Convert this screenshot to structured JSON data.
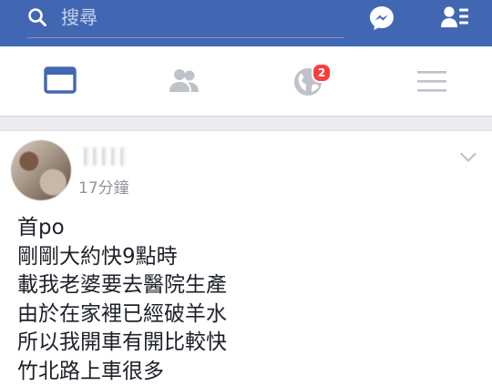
{
  "search": {
    "placeholder": "搜尋"
  },
  "header": {
    "icons": [
      "search-icon",
      "messenger-icon",
      "friend-requests-icon"
    ],
    "brand_color": "#4267b2"
  },
  "tabs": [
    {
      "name": "news-feed",
      "icon": "news-feed-icon",
      "active": true
    },
    {
      "name": "friends",
      "icon": "friends-icon",
      "active": false
    },
    {
      "name": "notifications",
      "icon": "globe-icon",
      "active": false,
      "badge": "2"
    },
    {
      "name": "menu",
      "icon": "hamburger-menu-icon",
      "active": false
    }
  ],
  "post": {
    "author": "",
    "timestamp": "17分鐘",
    "lines": [
      "首po",
      "剛剛大約快9點時",
      "載我老婆要去醫院生產",
      "由於在家裡已經破羊水",
      "所以我開車有開比較快",
      "竹北路上車很多"
    ]
  },
  "colors": {
    "badge": "#fa3e3e",
    "active_tab": "#4267b2",
    "inactive_tab": "#bec2c9"
  }
}
